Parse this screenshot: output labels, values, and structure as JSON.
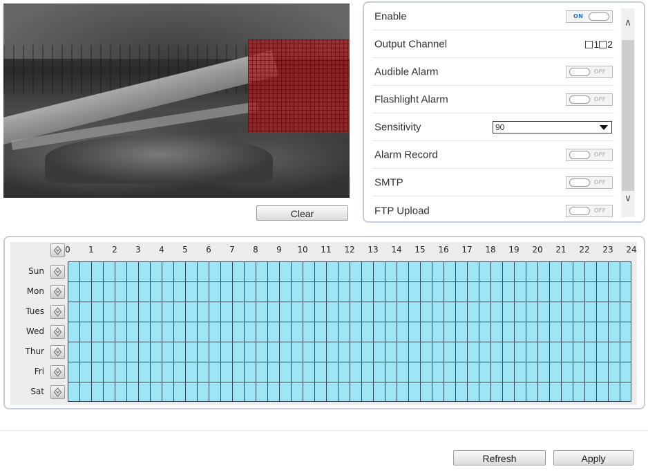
{
  "preview": {
    "clear_label": "Clear"
  },
  "settings": {
    "enable": {
      "label": "Enable",
      "state": "ON"
    },
    "output_channel": {
      "label": "Output Channel",
      "channels": [
        "1",
        "2"
      ]
    },
    "audible_alarm": {
      "label": "Audible Alarm",
      "state": "OFF"
    },
    "flashlight_alarm": {
      "label": "Flashlight Alarm",
      "state": "OFF"
    },
    "sensitivity": {
      "label": "Sensitivity",
      "value": "90"
    },
    "alarm_record": {
      "label": "Alarm Record",
      "state": "OFF"
    },
    "smtp": {
      "label": "SMTP",
      "state": "OFF"
    },
    "ftp_upload": {
      "label": "FTP Upload",
      "state": "OFF"
    }
  },
  "schedule": {
    "hours": [
      "0",
      "1",
      "2",
      "3",
      "4",
      "5",
      "6",
      "7",
      "8",
      "9",
      "10",
      "11",
      "12",
      "13",
      "14",
      "15",
      "16",
      "17",
      "18",
      "19",
      "20",
      "21",
      "22",
      "23",
      "24"
    ],
    "days": [
      "Sun",
      "Mon",
      "Tues",
      "Wed",
      "Thur",
      "Fri",
      "Sat"
    ],
    "fill_color": "#9ee6f6"
  },
  "footer": {
    "refresh_label": "Refresh",
    "apply_label": "Apply"
  }
}
